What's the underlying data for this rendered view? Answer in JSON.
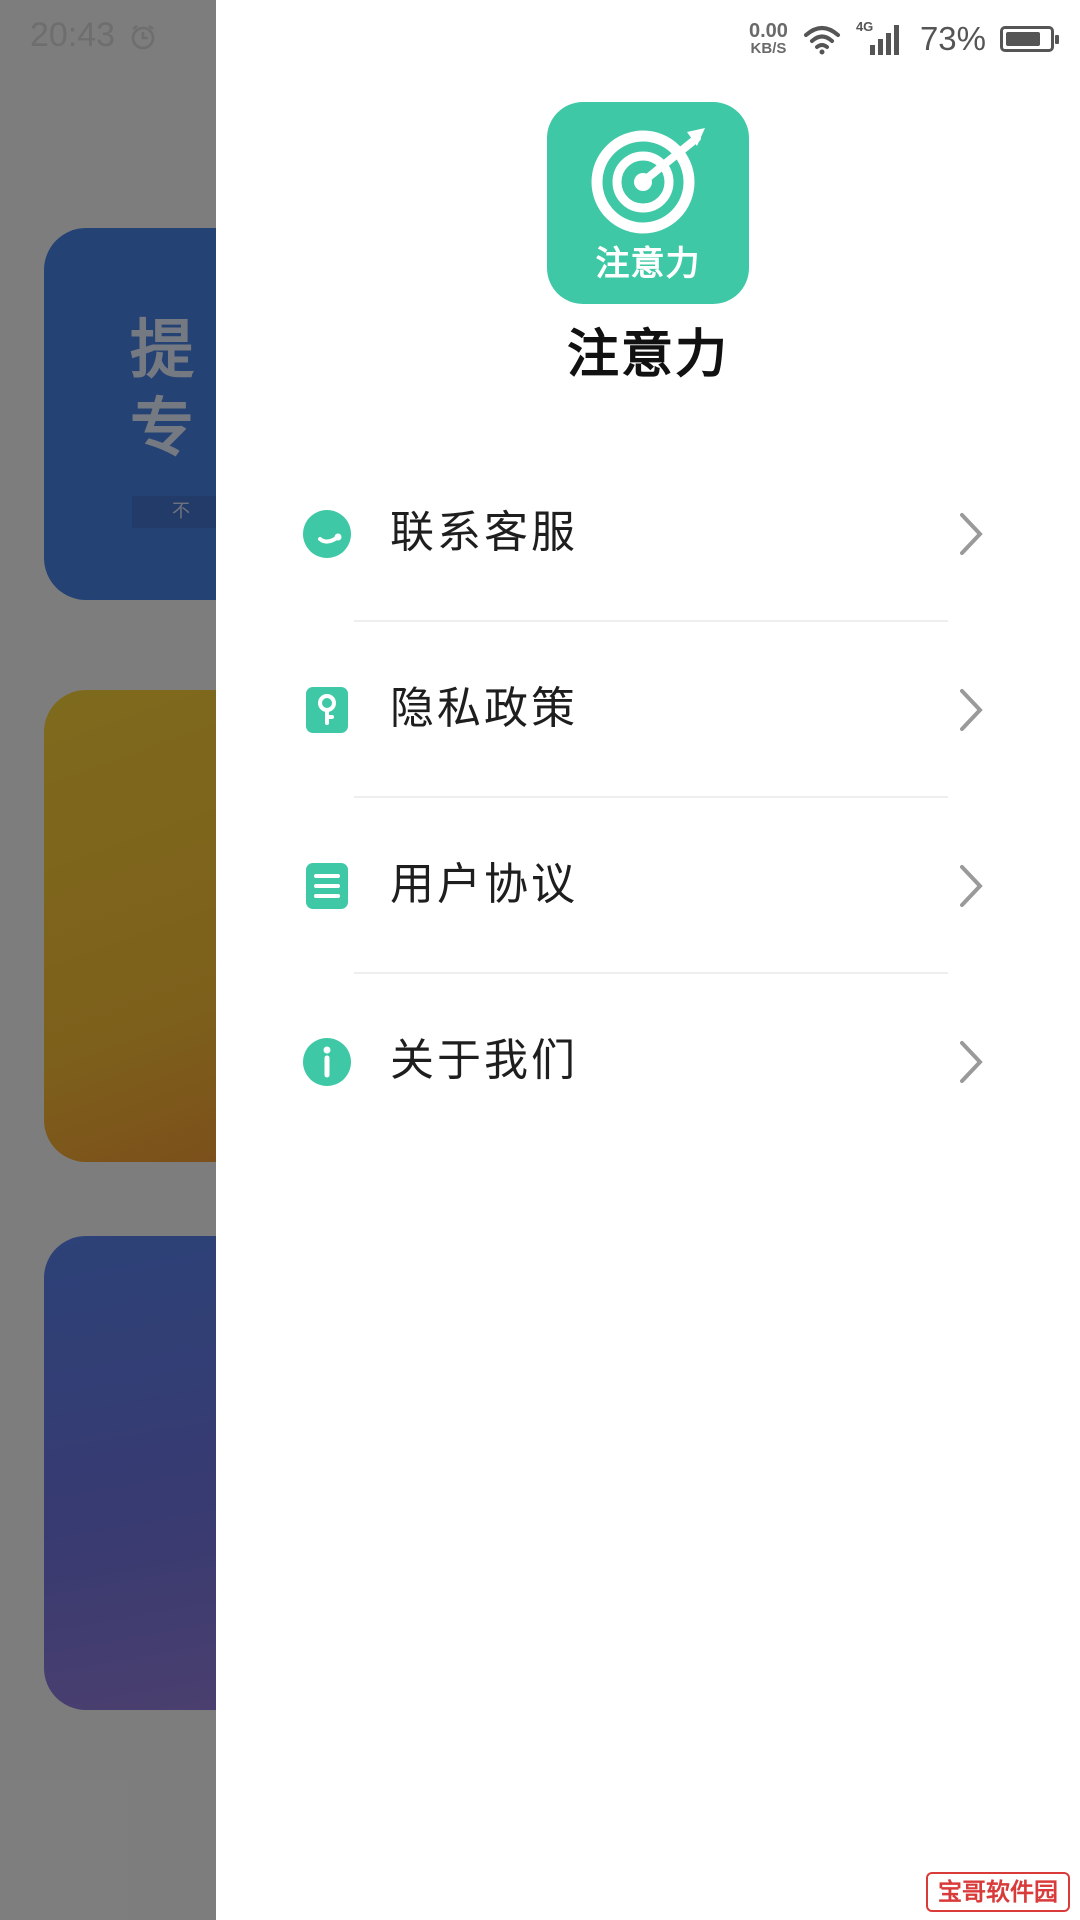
{
  "status_bar": {
    "time": "20:43",
    "net_speed_value": "0.00",
    "net_speed_unit": "KB/S",
    "network_type": "4G",
    "battery_percent": "73%"
  },
  "background": {
    "card1_title_line1": "提",
    "card1_title_line2": "专",
    "card1_sub": "不"
  },
  "drawer": {
    "logo_text": "注意力",
    "app_name": "注意力",
    "menu": [
      {
        "label": "联系客服",
        "icon": "customer-service-icon"
      },
      {
        "label": "隐私政策",
        "icon": "privacy-key-icon"
      },
      {
        "label": "用户协议",
        "icon": "document-icon"
      },
      {
        "label": "关于我们",
        "icon": "info-icon"
      }
    ]
  },
  "colors": {
    "accent": "#3fc8a6",
    "drawer_bg": "#ffffff",
    "scrim": "#4a4a4a"
  },
  "watermark": "宝哥软件园"
}
